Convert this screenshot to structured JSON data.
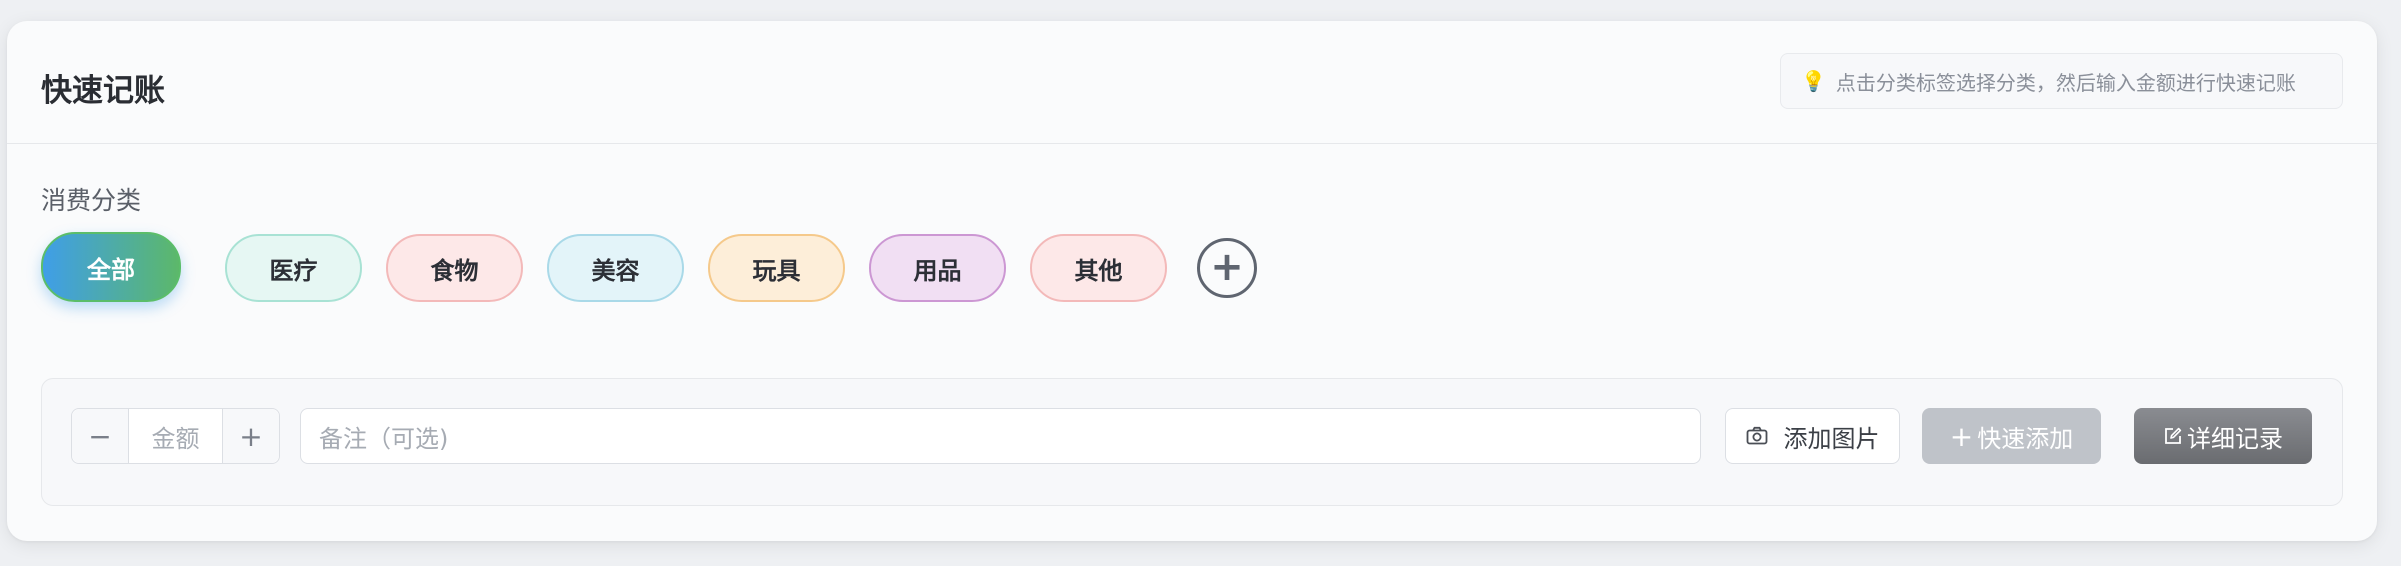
{
  "header": {
    "title": "快速记账",
    "tip": "点击分类标签选择分类，然后输入金额进行快速记账",
    "tip_icon": "lightbulb-icon"
  },
  "categories": {
    "label": "消费分类",
    "items": [
      {
        "label": "全部",
        "bg": "#3f9ee8",
        "border": "#5bbd6a",
        "selected": true
      },
      {
        "label": "医疗",
        "bg": "#e6f7f3",
        "border": "#a8e2d4",
        "selected": false
      },
      {
        "label": "食物",
        "bg": "#fde8e8",
        "border": "#f3b9b9",
        "selected": false
      },
      {
        "label": "美容",
        "bg": "#e3f4f9",
        "border": "#a9d9e8",
        "selected": false
      },
      {
        "label": "玩具",
        "bg": "#fdeed9",
        "border": "#f5c98b",
        "selected": false
      },
      {
        "label": "用品",
        "bg": "#f1dff3",
        "border": "#cc97d3",
        "selected": false
      },
      {
        "label": "其他",
        "bg": "#fde8e8",
        "border": "#f3b9b9",
        "selected": false
      }
    ],
    "add_icon": "plus-circle-icon"
  },
  "form": {
    "minus": "−",
    "amount_placeholder": "金额",
    "plus": "+",
    "note_placeholder": "备注（可选)",
    "add_image": "添加图片",
    "quick_add": "快速添加",
    "detail": "详细记录"
  }
}
